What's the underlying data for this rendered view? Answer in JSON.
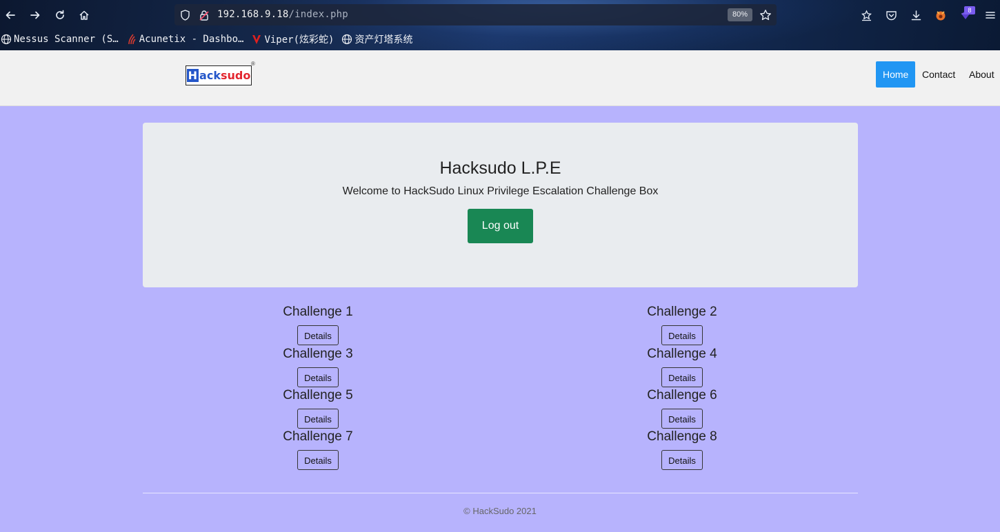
{
  "browser": {
    "url_host": "192.168.9.18",
    "url_path": "/index.php",
    "zoom": "80%",
    "extension_badge": "8",
    "bookmarks": [
      {
        "label": "Nessus Scanner (S…",
        "icon": "globe-icon"
      },
      {
        "label": "Acunetix - Dashbo…",
        "icon": "acunetix-icon"
      },
      {
        "label": "Viper(炫彩蛇)",
        "icon": "viper-icon"
      },
      {
        "label": "资产灯塔系统",
        "icon": "globe-icon"
      }
    ]
  },
  "navbar": {
    "logo_prefix": "H",
    "logo_mid": "ack",
    "logo_suffix": "sudo",
    "links": [
      "Home",
      "Contact",
      "About"
    ],
    "active": "Home"
  },
  "jumbotron": {
    "title": "Hacksudo L.P.E",
    "subtitle": "Welcome to HackSudo Linux Privilege Escalation Challenge Box",
    "logout_label": "Log out"
  },
  "challenges": [
    {
      "title": "Challenge 1",
      "button": "Details"
    },
    {
      "title": "Challenge 2",
      "button": "Details"
    },
    {
      "title": "Challenge 3",
      "button": "Details"
    },
    {
      "title": "Challenge 4",
      "button": "Details"
    },
    {
      "title": "Challenge 5",
      "button": "Details"
    },
    {
      "title": "Challenge 6",
      "button": "Details"
    },
    {
      "title": "Challenge 7",
      "button": "Details"
    },
    {
      "title": "Challenge 8",
      "button": "Details"
    }
  ],
  "footer": "© HackSudo 2021",
  "colors": {
    "page_bg": "#b7b3fd",
    "active_nav": "#2196f3",
    "logout_btn": "#198754",
    "jumbotron_bg": "#e9ecef"
  }
}
